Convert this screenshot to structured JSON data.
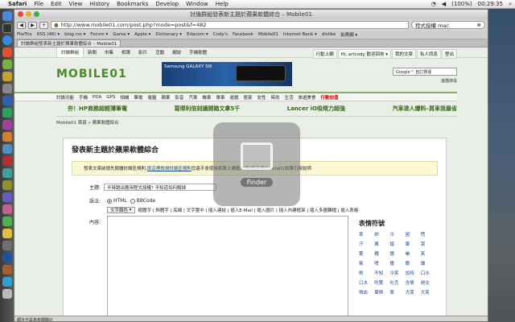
{
  "menubar": {
    "app": "Safari",
    "items": [
      "File",
      "Edit",
      "View",
      "History",
      "Bookmarks",
      "Develop",
      "Window",
      "Help"
    ],
    "battery": "(100%)",
    "time": "00:29:35"
  },
  "window": {
    "title": "討論群組發表新主題於蘋果軟體綜合 – Mobile01",
    "url": "http://www.mobile01.com/post.php?mode=post&f=482",
    "search_placeholder": "程式授權 mac"
  },
  "bookmarks": [
    "FileTrix",
    "RSS (46) ▾",
    "blog rss ▾",
    "Forum ▾",
    "Game ▾",
    "Apple ▾",
    "Dictionary ▾",
    "Edacom ▾",
    "Cody's",
    "Facebook",
    "Mobile01",
    "Internet Bank ▾",
    "dislike",
    "拍賣網 ▾"
  ],
  "tab_label": "討論群組發表新主題於蘋果軟體綜合 – Mobile01",
  "site": {
    "top_nav": [
      "討論群組",
      "新聞",
      "市集",
      "相簿",
      "影片",
      "活動",
      "網誌",
      "手機軟體"
    ],
    "top_right": [
      "行動上網",
      "Hi, artcody 歡迎回來 ▾",
      "我的文章",
      "私人訊息",
      "登出"
    ],
    "logo": "MOBILE01",
    "ad_text": "Samsung GALAXY SIII",
    "google_placeholder": "Google™ 自訂搜尋",
    "adv_search": "進階搜尋",
    "categories": [
      "討論功能",
      "手機",
      "PDA",
      "GPS",
      "相機",
      "筆電",
      "電腦",
      "蘋果",
      "影音",
      "汽車",
      "機車",
      "單車",
      "遊戲",
      "居家",
      "女性",
      "時尚",
      "生活",
      "旅遊美食"
    ],
    "categories_hot": "行動加值",
    "promos": [
      "夯！HP商務超輕薄筆電",
      "寫得利倍刻讓開箱文拿5千",
      "Lancer iO吸睛力超強",
      "汽車達人爆料–買車我最省"
    ],
    "breadcrumb": "Mobile01 首頁 » 蘋果軟體綜合"
  },
  "form": {
    "heading": "發表新主題於蘋果軟體綜合",
    "notice": "發表文章前請先閱讀討論區規則,",
    "notice_link": "按這裡檢視討論區規則",
    "notice_tail": "您還不會使用相簿上傳圖片嗎?請參考Mobile01相簿引用說明",
    "subject_label": "主題:",
    "subject_value": "不時跳出應用程式授權?  不知道如何解掉",
    "mode_label": "語法:",
    "mode_html": "HTML",
    "mode_bbcode": "BBCode",
    "color_select": "文字顏色",
    "toolbar": "粗體字 | 斜體字 | 底線 | 文字置中 | 插入連結 | 插入E-Mail | 插入圖片 | 插入內建框架 | 插入多圖轉檔 | 插入表格",
    "content_label": "內容:",
    "emoji_title": "表情符號",
    "emoji": [
      "茶",
      "帥",
      "冷",
      "困",
      "慌",
      "汗",
      "瘋",
      "錯",
      "暈",
      "哭",
      "驚",
      "糟",
      "讚",
      "嚇",
      "笑",
      "氣",
      "嗯",
      "撞",
      "撒",
      "讀",
      "刷",
      "不知",
      "冷笑",
      "加持",
      "口水",
      "口水",
      "吃驚",
      "吐舌",
      "含情",
      "絕交",
      "噴血",
      "暈倒",
      "寒",
      "大哭",
      "大笑"
    ]
  },
  "finder_label": "Finder",
  "status_text": "網址不是為有關聯比"
}
